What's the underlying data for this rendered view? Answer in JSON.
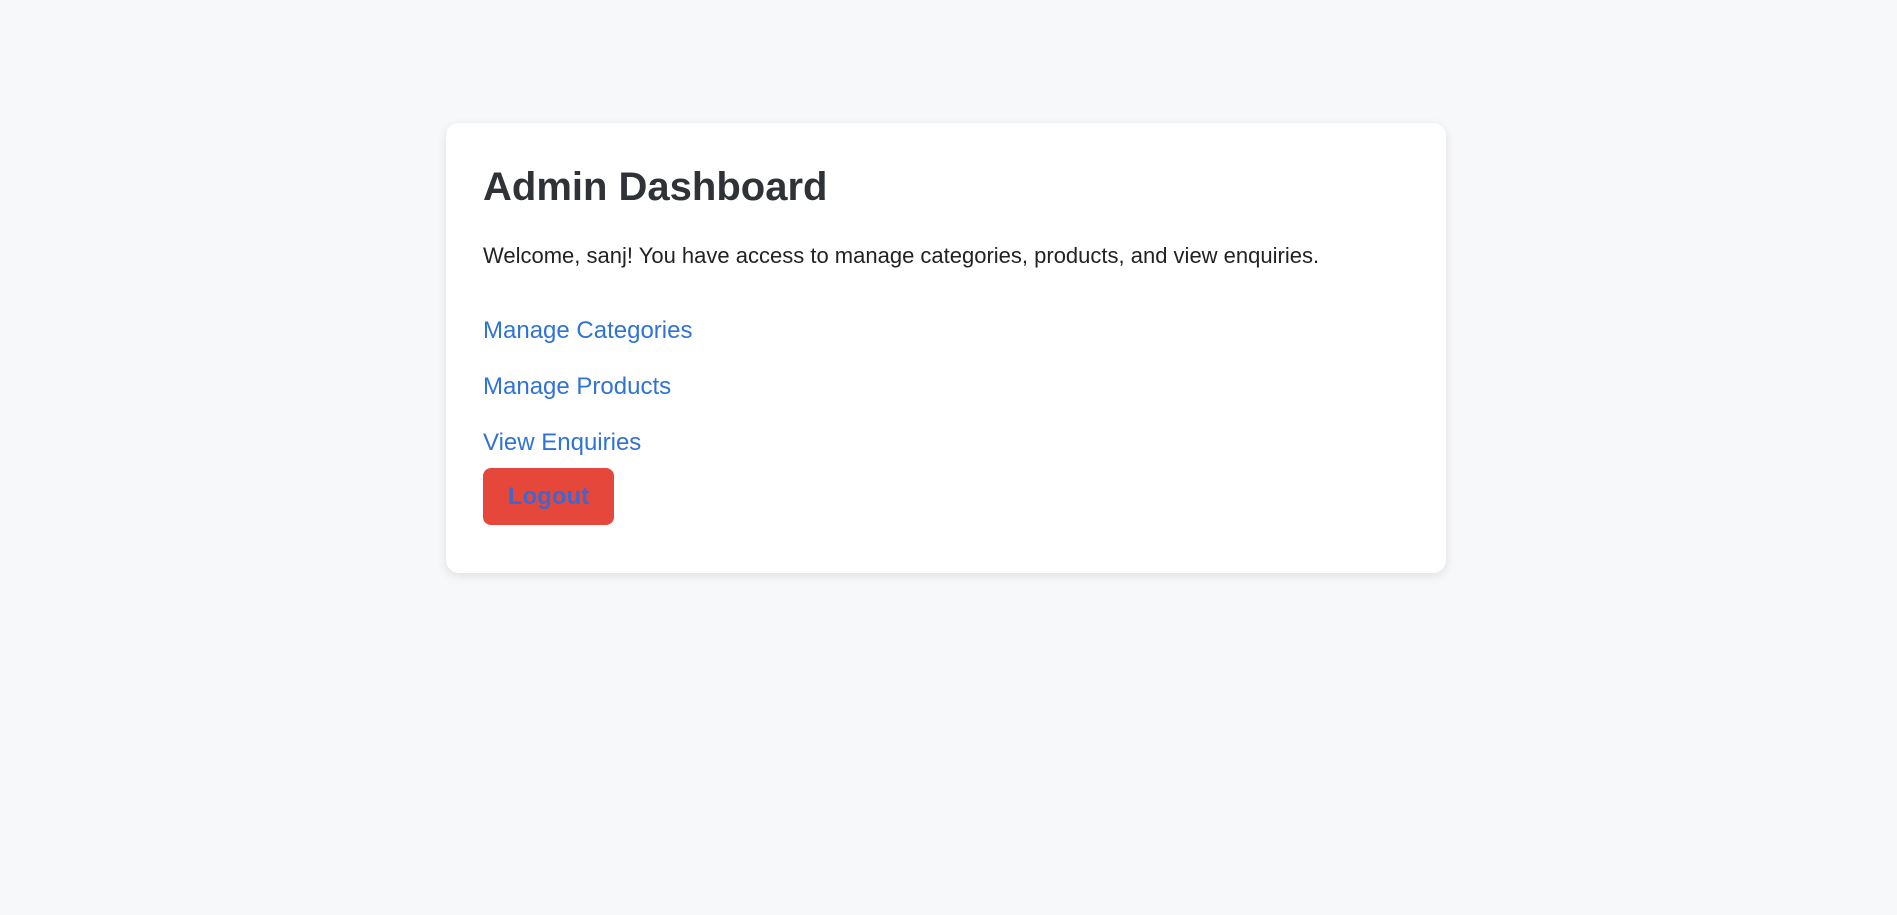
{
  "dashboard": {
    "title": "Admin Dashboard",
    "welcome_text": "Welcome, sanj! You have access to manage categories, products, and view enquiries.",
    "links": [
      {
        "label": "Manage Categories"
      },
      {
        "label": "Manage Products"
      },
      {
        "label": "View Enquiries"
      }
    ],
    "logout_label": "Logout"
  },
  "colors": {
    "page_background": "#f7f8fa",
    "card_background": "#ffffff",
    "link": "#2f73d8",
    "logout_button": "#e6473b",
    "logout_text": "#3f67cf",
    "title": "#2f3337"
  }
}
